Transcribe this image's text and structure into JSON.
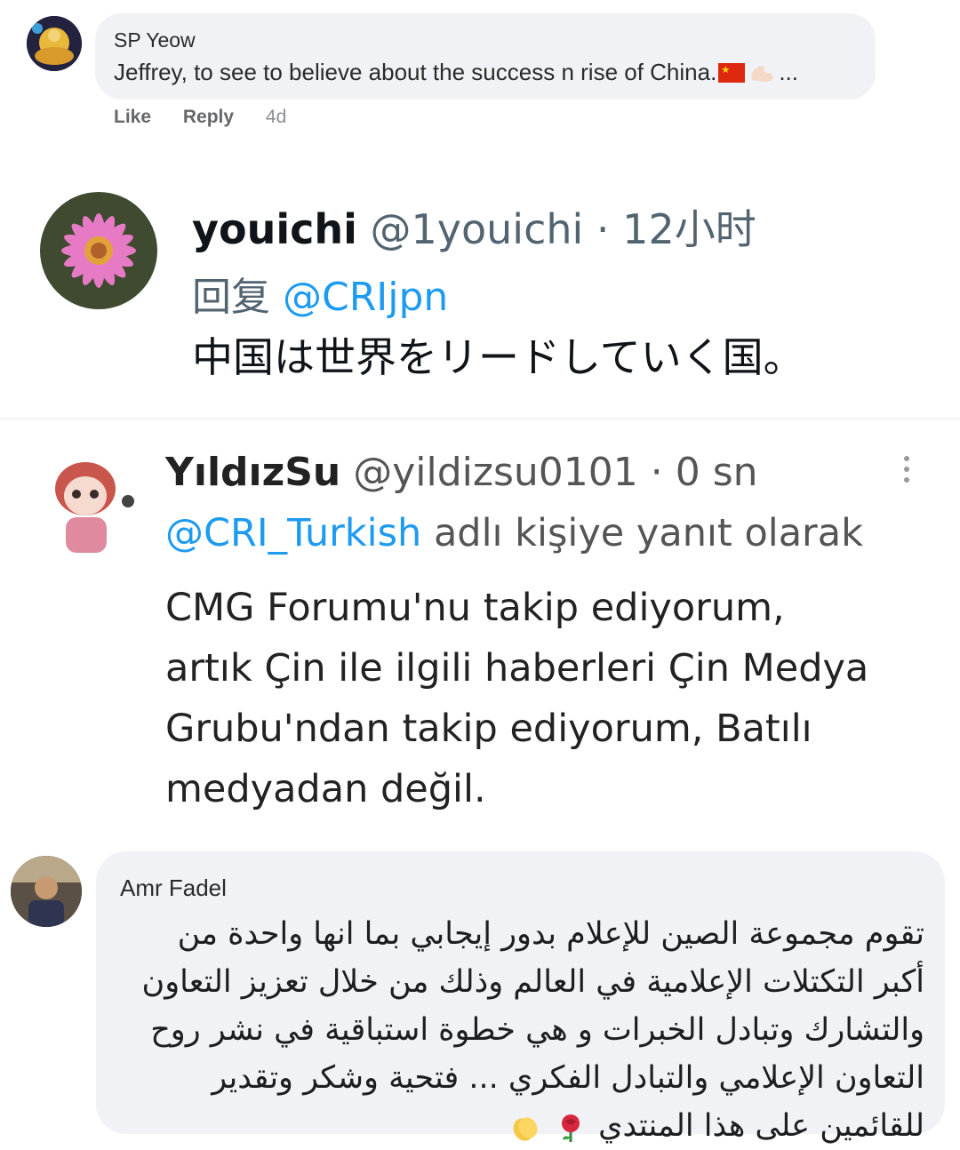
{
  "fb_comment": {
    "author": "SP Yeow",
    "text": "Jeffrey, to see to believe about the success n rise of China.",
    "ellipsis": "...",
    "flag_icon": "china-flag-icon",
    "muscle_icon": "flexed-biceps-icon",
    "actions": {
      "like": "Like",
      "reply": "Reply",
      "time": "4d"
    }
  },
  "tweet_youichi": {
    "name": "youichi",
    "meta": "@1youichi · 12小时",
    "reply_prefix": "回复",
    "reply_to": "@CRIjpn",
    "body": "中国は世界をリードしていく国。",
    "avatar_icon": "pink-flower-avatar"
  },
  "tweet_yildizsu": {
    "name": "YıldızSu",
    "meta": "@yildizsu0101 · 0 sn",
    "reply_to": "@CRI_Turkish",
    "reply_suffix": "adlı kişiye yanıt olarak",
    "body_lines": [
      "CMG Forumu'nu takip ediyorum,",
      "artık Çin ile ilgili haberleri Çin Medya",
      "Grubu'ndan takip ediyorum,  Batılı",
      "medyadan değil."
    ],
    "more_icon": "vertical-ellipsis-icon"
  },
  "fb_comment_amr": {
    "author": "Amr Fadel",
    "body_lines": [
      "تقوم مجموعة الصين للإعلام بدور إيجابي بما انها واحدة من",
      "أكبر التكتلات الإعلامية في العالم وذلك من خلال تعزيز التعاون",
      "والتشارك وتبادل الخبرات و هي خطوة استباقية في نشر روح",
      "التعاون الإعلامي والتبادل الفكري ... فتحية وشكر وتقدير",
      "للقائمين على هذا المنتدي"
    ],
    "emoji": [
      "rose-icon",
      "clapping-hands-icon"
    ]
  }
}
